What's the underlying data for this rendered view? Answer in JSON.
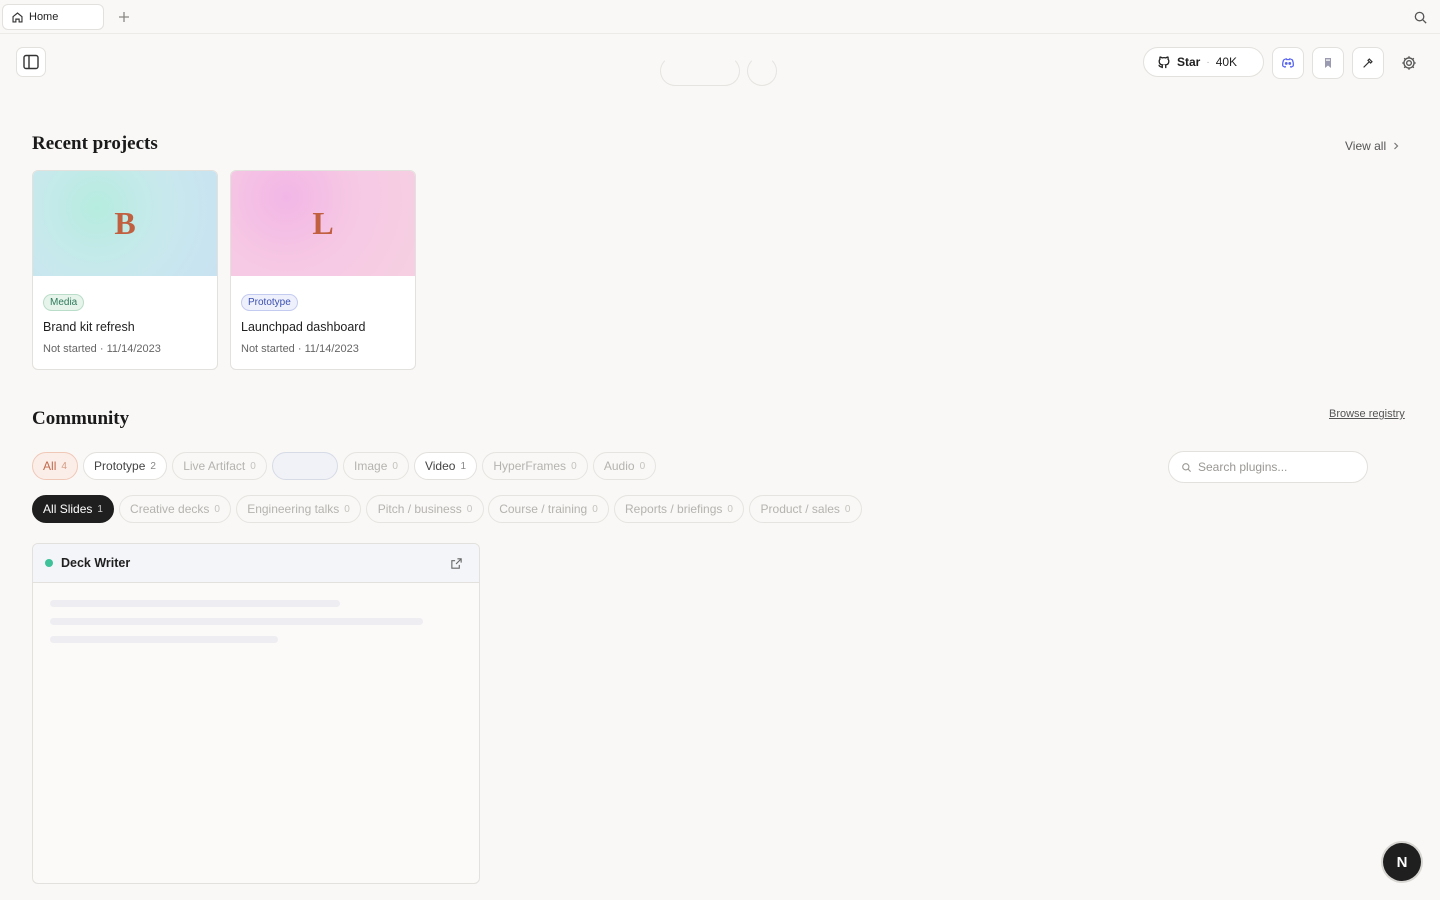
{
  "tabbar": {
    "tab_label": "Home"
  },
  "toolbar": {
    "star_label": "Star",
    "star_separator": "·",
    "star_count": "40K"
  },
  "recent": {
    "title": "Recent projects",
    "view_all": "View all",
    "projects": [
      {
        "initial": "B",
        "badge": "Media",
        "name": "Brand kit refresh",
        "status": "Not started",
        "date": "11/14/2023"
      },
      {
        "initial": "L",
        "badge": "Prototype",
        "name": "Launchpad dashboard",
        "status": "Not started",
        "date": "11/14/2023"
      }
    ]
  },
  "community": {
    "title": "Community",
    "browse_registry": "Browse registry",
    "filters": [
      {
        "label": "All",
        "count": "4"
      },
      {
        "label": "Prototype",
        "count": "2"
      },
      {
        "label": "Live Artifact",
        "count": "0"
      },
      {
        "label": "",
        "count": ""
      },
      {
        "label": "Image",
        "count": "0"
      },
      {
        "label": "Video",
        "count": "1"
      },
      {
        "label": "HyperFrames",
        "count": "0"
      },
      {
        "label": "Audio",
        "count": "0"
      }
    ],
    "search_placeholder": "Search plugins...",
    "subfilters": [
      {
        "label": "All Slides",
        "count": "1"
      },
      {
        "label": "Creative decks",
        "count": "0"
      },
      {
        "label": "Engineering talks",
        "count": "0"
      },
      {
        "label": "Pitch / business",
        "count": "0"
      },
      {
        "label": "Course / training",
        "count": "0"
      },
      {
        "label": "Reports / briefings",
        "count": "0"
      },
      {
        "label": "Product / sales",
        "count": "0"
      }
    ],
    "plugin": {
      "name": "Deck Writer",
      "status_color": "#3fc29a"
    }
  },
  "fab": {
    "label": "N"
  }
}
